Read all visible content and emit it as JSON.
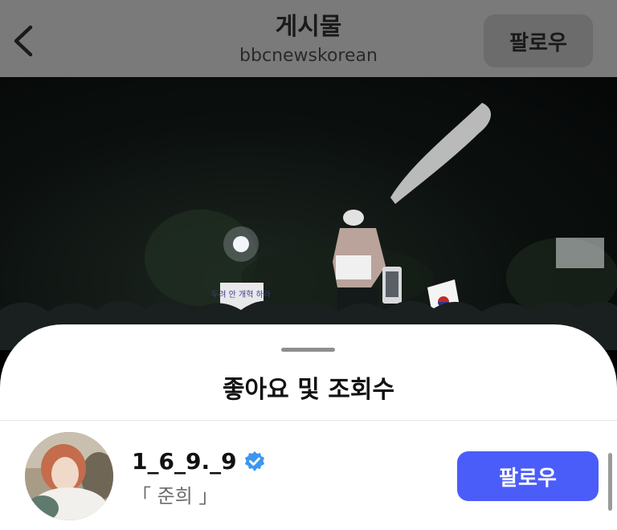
{
  "header": {
    "title": "게시물",
    "subtitle": "bbcnewskorean",
    "follow_label": "팔로우"
  },
  "media": {
    "sign_text": "두려 안 개혁 하라"
  },
  "sheet": {
    "title": "좋아요 및 조회수",
    "users": [
      {
        "username": "1_6_9._9",
        "verified": true,
        "full_name": "「 준희 」",
        "follow_label": "팔로우"
      }
    ]
  },
  "colors": {
    "accent": "#4a5df9",
    "verified": "#3b97f0",
    "header_dim": "#7a7a7a"
  }
}
